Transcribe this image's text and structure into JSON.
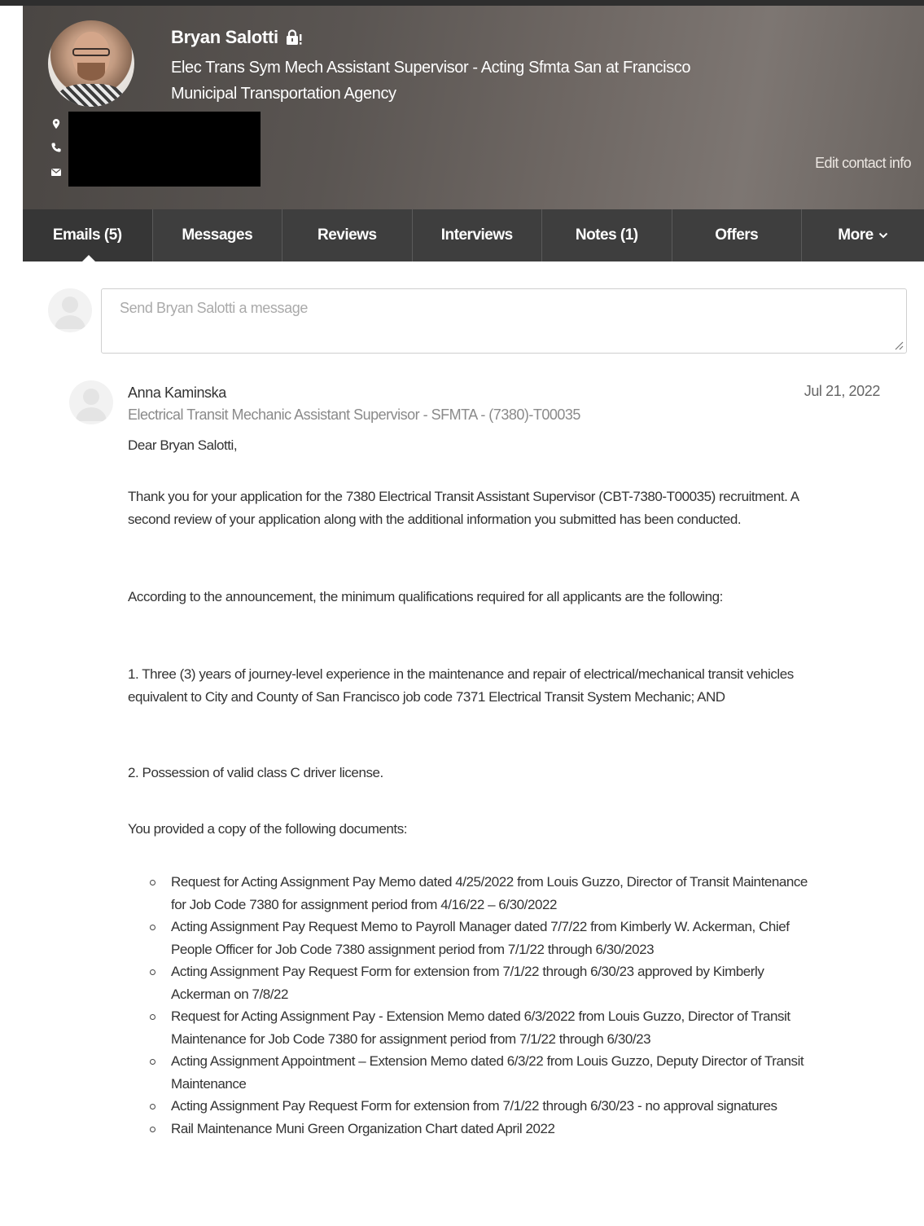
{
  "profile": {
    "name": "Bryan Salotti",
    "title": "Elec Trans Sym Mech Assistant Supervisor - Acting Sfmta San at Francisco Municipal Transportation Agency",
    "edit_contact_label": "Edit contact info"
  },
  "tabs": [
    {
      "label": "Emails (5)"
    },
    {
      "label": "Messages"
    },
    {
      "label": "Reviews"
    },
    {
      "label": "Interviews"
    },
    {
      "label": "Notes (1)"
    },
    {
      "label": "Offers"
    },
    {
      "label": "More"
    }
  ],
  "composer": {
    "placeholder": "Send Bryan Salotti a message"
  },
  "email": {
    "sender": "Anna Kaminska",
    "date": "Jul 21, 2022",
    "subject": "Electrical Transit Mechanic Assistant Supervisor - SFMTA - (7380)-T00035",
    "greeting": "Dear Bryan Salotti,",
    "paragraphs": [
      "Thank you for your application for the 7380 Electrical Transit Assistant Supervisor (CBT-7380-T00035) recruitment. A second review of your application along with the additional information you submitted has been conducted.",
      "According to the announcement, the minimum qualifications required for all applicants are the following:",
      "1. Three (3) years of journey-level experience in the maintenance and repair of electrical/mechanical transit vehicles equivalent to City and County of San Francisco job code 7371 Electrical Transit System Mechanic; AND",
      "2. Possession of valid class C driver license.",
      "You provided a copy of the following documents:"
    ],
    "documents": [
      "Request for Acting Assignment Pay Memo dated 4/25/2022 from Louis Guzzo, Director of Transit Maintenance for Job Code 7380 for assignment period from 4/16/22 – 6/30/2022",
      " Acting Assignment Pay Request Memo to Payroll Manager dated 7/7/22 from Kimberly W. Ackerman, Chief People Officer for Job Code 7380 assignment period from 7/1/22 through 6/30/2023",
      "Acting Assignment Pay Request Form for extension from 7/1/22 through 6/30/23 approved by Kimberly Ackerman on 7/8/22",
      "Request for Acting Assignment Pay - Extension Memo dated 6/3/2022 from Louis Guzzo, Director of Transit Maintenance for Job Code 7380 for assignment period from 7/1/22 through 6/30/23",
      "Acting Assignment Appointment – Extension Memo dated 6/3/22 from Louis Guzzo, Deputy Director of Transit Maintenance",
      "Acting Assignment Pay Request Form for extension from 7/1/22 through 6/30/23 - no approval signatures",
      "Rail Maintenance Muni Green Organization Chart dated April 2022"
    ]
  },
  "icons": {
    "lock": "lock-icon",
    "location": "map-pin-icon",
    "phone": "phone-icon",
    "mail": "envelope-icon",
    "chevron": "chevron-down-icon"
  },
  "colors": {
    "tab_bar": "#3e3e3e",
    "header_bg": "#5a5552"
  }
}
